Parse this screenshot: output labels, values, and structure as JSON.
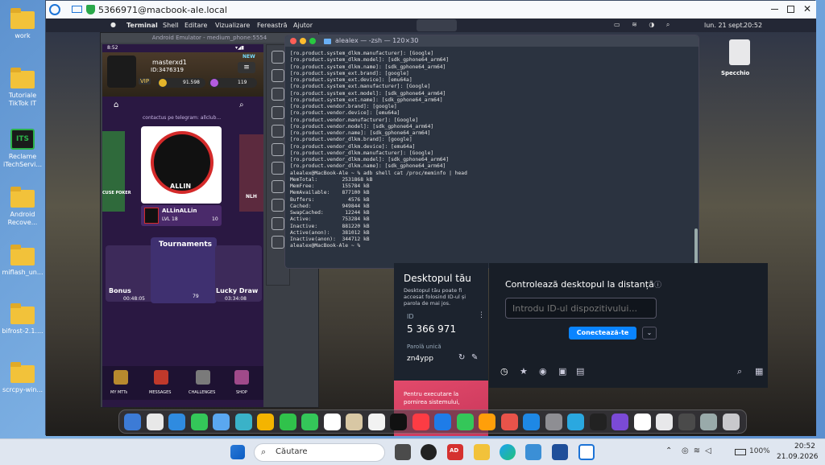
{
  "desktop": {
    "icons": [
      {
        "label": "work",
        "kind": "folder"
      },
      {
        "label": "Tutoriale TikTok IT",
        "kind": "folder"
      },
      {
        "label": "Reclame iTechServi...",
        "kind": "app"
      },
      {
        "label": "Android Recove...",
        "kind": "folder"
      },
      {
        "label": "miflash_un...",
        "kind": "folder"
      },
      {
        "label": "bifrost-2.1....",
        "kind": "folder"
      },
      {
        "label": "scrcpy-win...",
        "kind": "folder"
      }
    ]
  },
  "remote_window": {
    "title": "5366971@macbook-ale.local"
  },
  "mac": {
    "menubar": {
      "items": [
        "Terminal",
        "Shell",
        "Editare",
        "Vizualizare",
        "Fereastră",
        "Ajutor"
      ],
      "date": "lun. 21 sept.",
      "time": "20:52"
    },
    "desktop_icon": "Specchio",
    "emulator": {
      "title": "Android Emulator - medium_phone:5554",
      "status_time": "8:52",
      "username": "masterxd1",
      "user_id": "ID:3476319",
      "new1": "NEW",
      "new2": "NEW",
      "vip": "VIP",
      "coins": "91.598",
      "gems": "119",
      "marquee": "contactus pe telegram: allclub...",
      "club_name": "ALLinALLin",
      "club_level": "LVL 18",
      "club_members": "10",
      "club_logo_text": "ALLIN",
      "left_card": "CUSE POKER",
      "right_card": "NLH",
      "tiles": [
        {
          "label": "Bonus",
          "timer": "00:48:05"
        },
        {
          "label": "Tournaments",
          "count": "79"
        },
        {
          "label": "Lucky Draw",
          "timer": "03:34:08"
        }
      ],
      "nav": [
        "MY MTTs",
        "MESSAGES",
        "CHALLENGES",
        "SHOP"
      ]
    },
    "terminal": {
      "title": "alealex — -zsh — 120×30",
      "lines": [
        "[ro.product.system_dlkm.manufacturer]: [Google]",
        "[ro.product.system_dlkm.model]: [sdk_gphone64_arm64]",
        "[ro.product.system_dlkm.name]: [sdk_gphone64_arm64]",
        "[ro.product.system_ext.brand]: [google]",
        "[ro.product.system_ext.device]: [emu64a]",
        "[ro.product.system_ext.manufacturer]: [Google]",
        "[ro.product.system_ext.model]: [sdk_gphone64_arm64]",
        "[ro.product.system_ext.name]: [sdk_gphone64_arm64]",
        "[ro.product.vendor.brand]: [google]",
        "[ro.product.vendor.device]: [emu64a]",
        "[ro.product.vendor.manufacturer]: [Google]",
        "[ro.product.vendor.model]: [sdk_gphone64_arm64]",
        "[ro.product.vendor.name]: [sdk_gphone64_arm64]",
        "[ro.product.vendor_dlkm.brand]: [google]",
        "[ro.product.vendor_dlkm.device]: [emu64a]",
        "[ro.product.vendor_dlkm.manufacturer]: [Google]",
        "[ro.product.vendor_dlkm.model]: [sdk_gphone64_arm64]",
        "[ro.product.vendor_dlkm.name]: [sdk_gphone64_arm64]",
        "alealex@MacBook-Ale ~ % adb shell cat /proc/meminfo | head",
        "MemTotal:        2531868 kB",
        "MemFree:         155784 kB",
        "MemAvailable:    877100 kB",
        "Buffers:           4576 kB",
        "Cached:          949844 kB",
        "SwapCached:       12244 kB",
        "Active:          753284 kB",
        "Inactive:        881220 kB",
        "Active(anon):    381012 kB",
        "Inactive(anon):  344712 kB",
        "alealex@MacBook-Ale ~ % "
      ]
    },
    "remote_panel": {
      "title": "Desktopul tău",
      "desc": "Desktopul tău poate fi accesat folosind ID-ul și parola de mai jos.",
      "id_label": "ID",
      "id_value": "5 366 971",
      "pwd_label": "Parolă unică",
      "pwd_value": "zn4ypp"
    },
    "connect_panel": {
      "title": "Controlează desktopul la distanță",
      "placeholder": "Introdu ID-ul dispozitivului...",
      "button": "Conectează-te"
    },
    "pink_card": {
      "text": "Pentru executare la pornirea sistemului,"
    }
  },
  "taskbar": {
    "search": "Căutare",
    "battery": "100%",
    "time": "20:52",
    "date": "21.09.2026",
    "badge": "AD"
  },
  "colors": {
    "accent": "#0a84ff",
    "terminal_bg": "#2b3340",
    "pink": "#e24a6b",
    "taskbar": "#dfe6f0"
  }
}
